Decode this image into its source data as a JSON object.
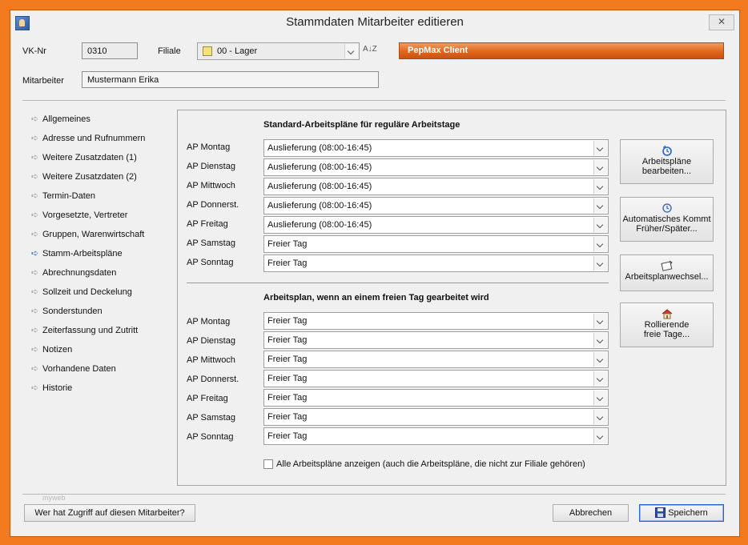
{
  "window": {
    "title": "Stammdaten Mitarbeiter editieren",
    "close_label": "✕"
  },
  "header": {
    "vk_label": "VK-Nr",
    "vk_value": "0310",
    "filiale_label": "Filiale",
    "filiale_value": "00 - Lager",
    "sort_icon_label": "A↓Z",
    "mitarbeiter_label": "Mitarbeiter",
    "mitarbeiter_value": "Mustermann Erika",
    "app_banner": "PepMax Client"
  },
  "sidebar": {
    "items": [
      {
        "label": "Allgemeines"
      },
      {
        "label": "Adresse und Rufnummern"
      },
      {
        "label": "Weitere Zusatzdaten (1)"
      },
      {
        "label": "Weitere Zusatzdaten (2)"
      },
      {
        "label": "Termin-Daten"
      },
      {
        "label": "Vorgesetzte, Vertreter"
      },
      {
        "label": "Gruppen, Warenwirtschaft"
      },
      {
        "label": "Stamm-Arbeitspläne"
      },
      {
        "label": "Abrechnungsdaten"
      },
      {
        "label": "Sollzeit und Deckelung"
      },
      {
        "label": "Sonderstunden"
      },
      {
        "label": "Zeiterfassung und Zutritt"
      },
      {
        "label": "Notizen"
      },
      {
        "label": "Vorhandene Daten"
      },
      {
        "label": "Historie"
      }
    ],
    "arrow_glyph": "➪"
  },
  "standard": {
    "title": "Standard-Arbeitspläne für reguläre Arbeitstage",
    "rows": [
      {
        "label": "AP Montag",
        "value": "Auslieferung (08:00-16:45)"
      },
      {
        "label": "AP Dienstag",
        "value": "Auslieferung (08:00-16:45)"
      },
      {
        "label": "AP Mittwoch",
        "value": "Auslieferung (08:00-16:45)"
      },
      {
        "label": "AP Donnerst.",
        "value": "Auslieferung (08:00-16:45)"
      },
      {
        "label": "AP Freitag",
        "value": "Auslieferung (08:00-16:45)"
      },
      {
        "label": "AP Samstag",
        "value": "Freier Tag"
      },
      {
        "label": "AP Sonntag",
        "value": "Freier Tag"
      }
    ]
  },
  "freeday": {
    "title": "Arbeitsplan, wenn an einem freien Tag gearbeitet wird",
    "rows": [
      {
        "label": "AP Montag",
        "value": "Freier Tag"
      },
      {
        "label": "AP Dienstag",
        "value": "Freier Tag"
      },
      {
        "label": "AP Mittwoch",
        "value": "Freier Tag"
      },
      {
        "label": "AP Donnerst.",
        "value": "Freier Tag"
      },
      {
        "label": "AP Freitag",
        "value": "Freier Tag"
      },
      {
        "label": "AP Samstag",
        "value": "Freier Tag"
      },
      {
        "label": "AP Sonntag",
        "value": "Freier Tag"
      }
    ]
  },
  "checkbox": {
    "label": "Alle Arbeitspläne anzeigen (auch die Arbeitspläne, die nicht zur Filiale gehören)",
    "checked": false
  },
  "side_buttons": {
    "edit_line1": "Arbeitspläne",
    "edit_line2": "bearbeiten...",
    "auto_line1": "Automatisches Kommt",
    "auto_line2": "Früher/Später...",
    "change_line1": "Arbeitsplanwechsel...",
    "rolling_line1": "Rollierende",
    "rolling_line2": "freie Tage..."
  },
  "footer": {
    "watermark": "myweb",
    "access_button": "Wer hat Zugriff auf diesen Mitarbeiter?",
    "cancel_button": "Abbrechen",
    "save_button": "Speichern"
  },
  "colors": {
    "frame_orange": "#f47a1f",
    "banner_orange": "#e0661e",
    "active_arrow": "#2b64c8"
  }
}
